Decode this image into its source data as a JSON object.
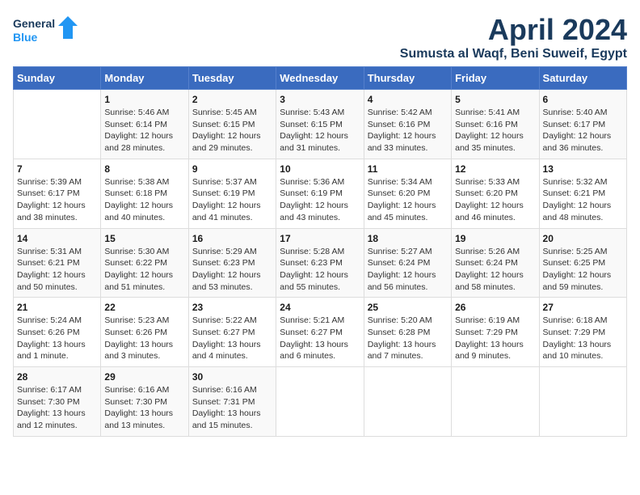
{
  "logo": {
    "text_general": "General",
    "text_blue": "Blue"
  },
  "title": "April 2024",
  "subtitle": "Sumusta al Waqf, Beni Suweif, Egypt",
  "weekdays": [
    "Sunday",
    "Monday",
    "Tuesday",
    "Wednesday",
    "Thursday",
    "Friday",
    "Saturday"
  ],
  "weeks": [
    [
      {
        "day": "",
        "info": ""
      },
      {
        "day": "1",
        "info": "Sunrise: 5:46 AM\nSunset: 6:14 PM\nDaylight: 12 hours\nand 28 minutes."
      },
      {
        "day": "2",
        "info": "Sunrise: 5:45 AM\nSunset: 6:15 PM\nDaylight: 12 hours\nand 29 minutes."
      },
      {
        "day": "3",
        "info": "Sunrise: 5:43 AM\nSunset: 6:15 PM\nDaylight: 12 hours\nand 31 minutes."
      },
      {
        "day": "4",
        "info": "Sunrise: 5:42 AM\nSunset: 6:16 PM\nDaylight: 12 hours\nand 33 minutes."
      },
      {
        "day": "5",
        "info": "Sunrise: 5:41 AM\nSunset: 6:16 PM\nDaylight: 12 hours\nand 35 minutes."
      },
      {
        "day": "6",
        "info": "Sunrise: 5:40 AM\nSunset: 6:17 PM\nDaylight: 12 hours\nand 36 minutes."
      }
    ],
    [
      {
        "day": "7",
        "info": "Sunrise: 5:39 AM\nSunset: 6:17 PM\nDaylight: 12 hours\nand 38 minutes."
      },
      {
        "day": "8",
        "info": "Sunrise: 5:38 AM\nSunset: 6:18 PM\nDaylight: 12 hours\nand 40 minutes."
      },
      {
        "day": "9",
        "info": "Sunrise: 5:37 AM\nSunset: 6:19 PM\nDaylight: 12 hours\nand 41 minutes."
      },
      {
        "day": "10",
        "info": "Sunrise: 5:36 AM\nSunset: 6:19 PM\nDaylight: 12 hours\nand 43 minutes."
      },
      {
        "day": "11",
        "info": "Sunrise: 5:34 AM\nSunset: 6:20 PM\nDaylight: 12 hours\nand 45 minutes."
      },
      {
        "day": "12",
        "info": "Sunrise: 5:33 AM\nSunset: 6:20 PM\nDaylight: 12 hours\nand 46 minutes."
      },
      {
        "day": "13",
        "info": "Sunrise: 5:32 AM\nSunset: 6:21 PM\nDaylight: 12 hours\nand 48 minutes."
      }
    ],
    [
      {
        "day": "14",
        "info": "Sunrise: 5:31 AM\nSunset: 6:21 PM\nDaylight: 12 hours\nand 50 minutes."
      },
      {
        "day": "15",
        "info": "Sunrise: 5:30 AM\nSunset: 6:22 PM\nDaylight: 12 hours\nand 51 minutes."
      },
      {
        "day": "16",
        "info": "Sunrise: 5:29 AM\nSunset: 6:23 PM\nDaylight: 12 hours\nand 53 minutes."
      },
      {
        "day": "17",
        "info": "Sunrise: 5:28 AM\nSunset: 6:23 PM\nDaylight: 12 hours\nand 55 minutes."
      },
      {
        "day": "18",
        "info": "Sunrise: 5:27 AM\nSunset: 6:24 PM\nDaylight: 12 hours\nand 56 minutes."
      },
      {
        "day": "19",
        "info": "Sunrise: 5:26 AM\nSunset: 6:24 PM\nDaylight: 12 hours\nand 58 minutes."
      },
      {
        "day": "20",
        "info": "Sunrise: 5:25 AM\nSunset: 6:25 PM\nDaylight: 12 hours\nand 59 minutes."
      }
    ],
    [
      {
        "day": "21",
        "info": "Sunrise: 5:24 AM\nSunset: 6:26 PM\nDaylight: 13 hours\nand 1 minute."
      },
      {
        "day": "22",
        "info": "Sunrise: 5:23 AM\nSunset: 6:26 PM\nDaylight: 13 hours\nand 3 minutes."
      },
      {
        "day": "23",
        "info": "Sunrise: 5:22 AM\nSunset: 6:27 PM\nDaylight: 13 hours\nand 4 minutes."
      },
      {
        "day": "24",
        "info": "Sunrise: 5:21 AM\nSunset: 6:27 PM\nDaylight: 13 hours\nand 6 minutes."
      },
      {
        "day": "25",
        "info": "Sunrise: 5:20 AM\nSunset: 6:28 PM\nDaylight: 13 hours\nand 7 minutes."
      },
      {
        "day": "26",
        "info": "Sunrise: 6:19 AM\nSunset: 7:29 PM\nDaylight: 13 hours\nand 9 minutes."
      },
      {
        "day": "27",
        "info": "Sunrise: 6:18 AM\nSunset: 7:29 PM\nDaylight: 13 hours\nand 10 minutes."
      }
    ],
    [
      {
        "day": "28",
        "info": "Sunrise: 6:17 AM\nSunset: 7:30 PM\nDaylight: 13 hours\nand 12 minutes."
      },
      {
        "day": "29",
        "info": "Sunrise: 6:16 AM\nSunset: 7:30 PM\nDaylight: 13 hours\nand 13 minutes."
      },
      {
        "day": "30",
        "info": "Sunrise: 6:16 AM\nSunset: 7:31 PM\nDaylight: 13 hours\nand 15 minutes."
      },
      {
        "day": "",
        "info": ""
      },
      {
        "day": "",
        "info": ""
      },
      {
        "day": "",
        "info": ""
      },
      {
        "day": "",
        "info": ""
      }
    ]
  ]
}
